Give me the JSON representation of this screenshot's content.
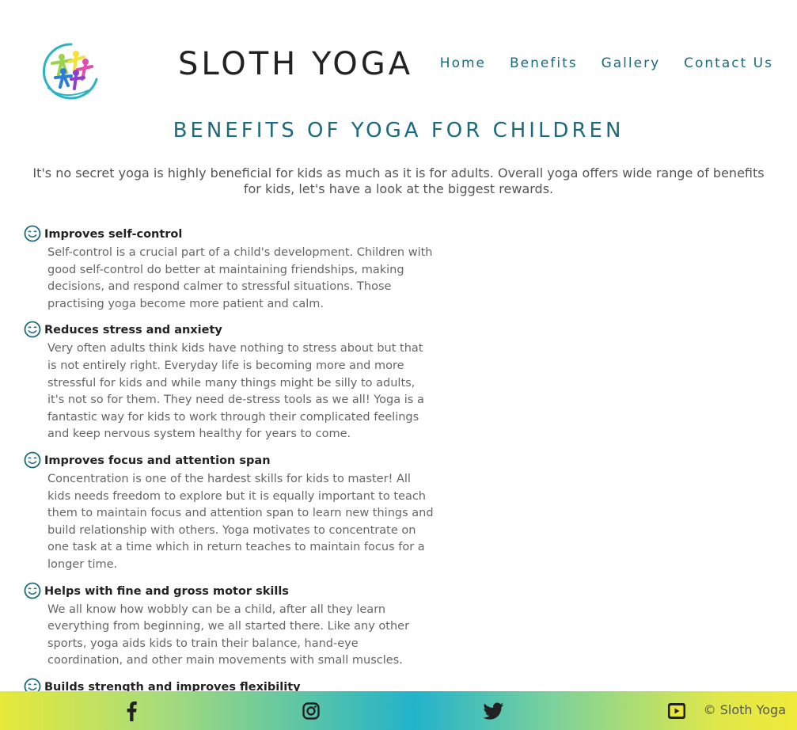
{
  "brand": {
    "name": "SLOTH YOGA"
  },
  "nav": {
    "items": [
      {
        "label": "Home"
      },
      {
        "label": "Benefits"
      },
      {
        "label": "Gallery"
      },
      {
        "label": "Contact Us"
      }
    ]
  },
  "main": {
    "title": "Benefits of yoga for children",
    "intro": "It's no secret yoga is highly beneficial for kids as much as it is for adults. Overall yoga offers wide range of benefits for kids, let's have a look at the biggest rewards.",
    "benefits": [
      {
        "icon": "smile-icon",
        "title": "Improves self-control",
        "text": "Self-control is a crucial part of a child's development. Children with good self-control do better at maintaining friendships, making decisions, and respond calmer to stressful situations. Those practising yoga become more patient and calm."
      },
      {
        "icon": "smile-icon",
        "title": "Reduces stress and anxiety",
        "text": "Very often adults think kids have nothing to stress about but that is not entirely right. Everyday life is becoming more and more stressful for kids and while many things might be silly to adults, it's not so for them. They need de-stress tools as we all! Yoga is a fantastic way for kids to work through their complicated feelings and keep nervous system healthy for years to come."
      },
      {
        "icon": "smile-icon",
        "title": "Improves focus and attention span",
        "text": "Concentration is one of the hardest skills for kids to master! All kids needs freedom to explore but it is equally important to teach them to maintain focus and attention span to learn new things and build relationship with others. Yoga motivates to concentrate on one task at a time which in return teaches to maintain focus for a longer time."
      },
      {
        "icon": "smile-icon",
        "title": "Helps with fine and gross motor skills",
        "text": "We all know how wobbly can be a child, after all they learn everything from beginning, we all started there. Like any other sports, yoga aids kids to train their balance, hand-eye coordination, and other main movements with small muscles."
      },
      {
        "icon": "smile-icon",
        "title": "Builds strength and improves flexibility",
        "text": ""
      }
    ]
  },
  "footer": {
    "social": [
      "facebook-icon",
      "instagram-icon",
      "twitter-icon",
      "youtube-icon"
    ],
    "copyright": "© Sloth Yoga"
  },
  "colors": {
    "accent": "#1c6b7d",
    "footer_gradient": [
      "#e6e93a",
      "#22b3cc",
      "#f0ea3a"
    ]
  }
}
